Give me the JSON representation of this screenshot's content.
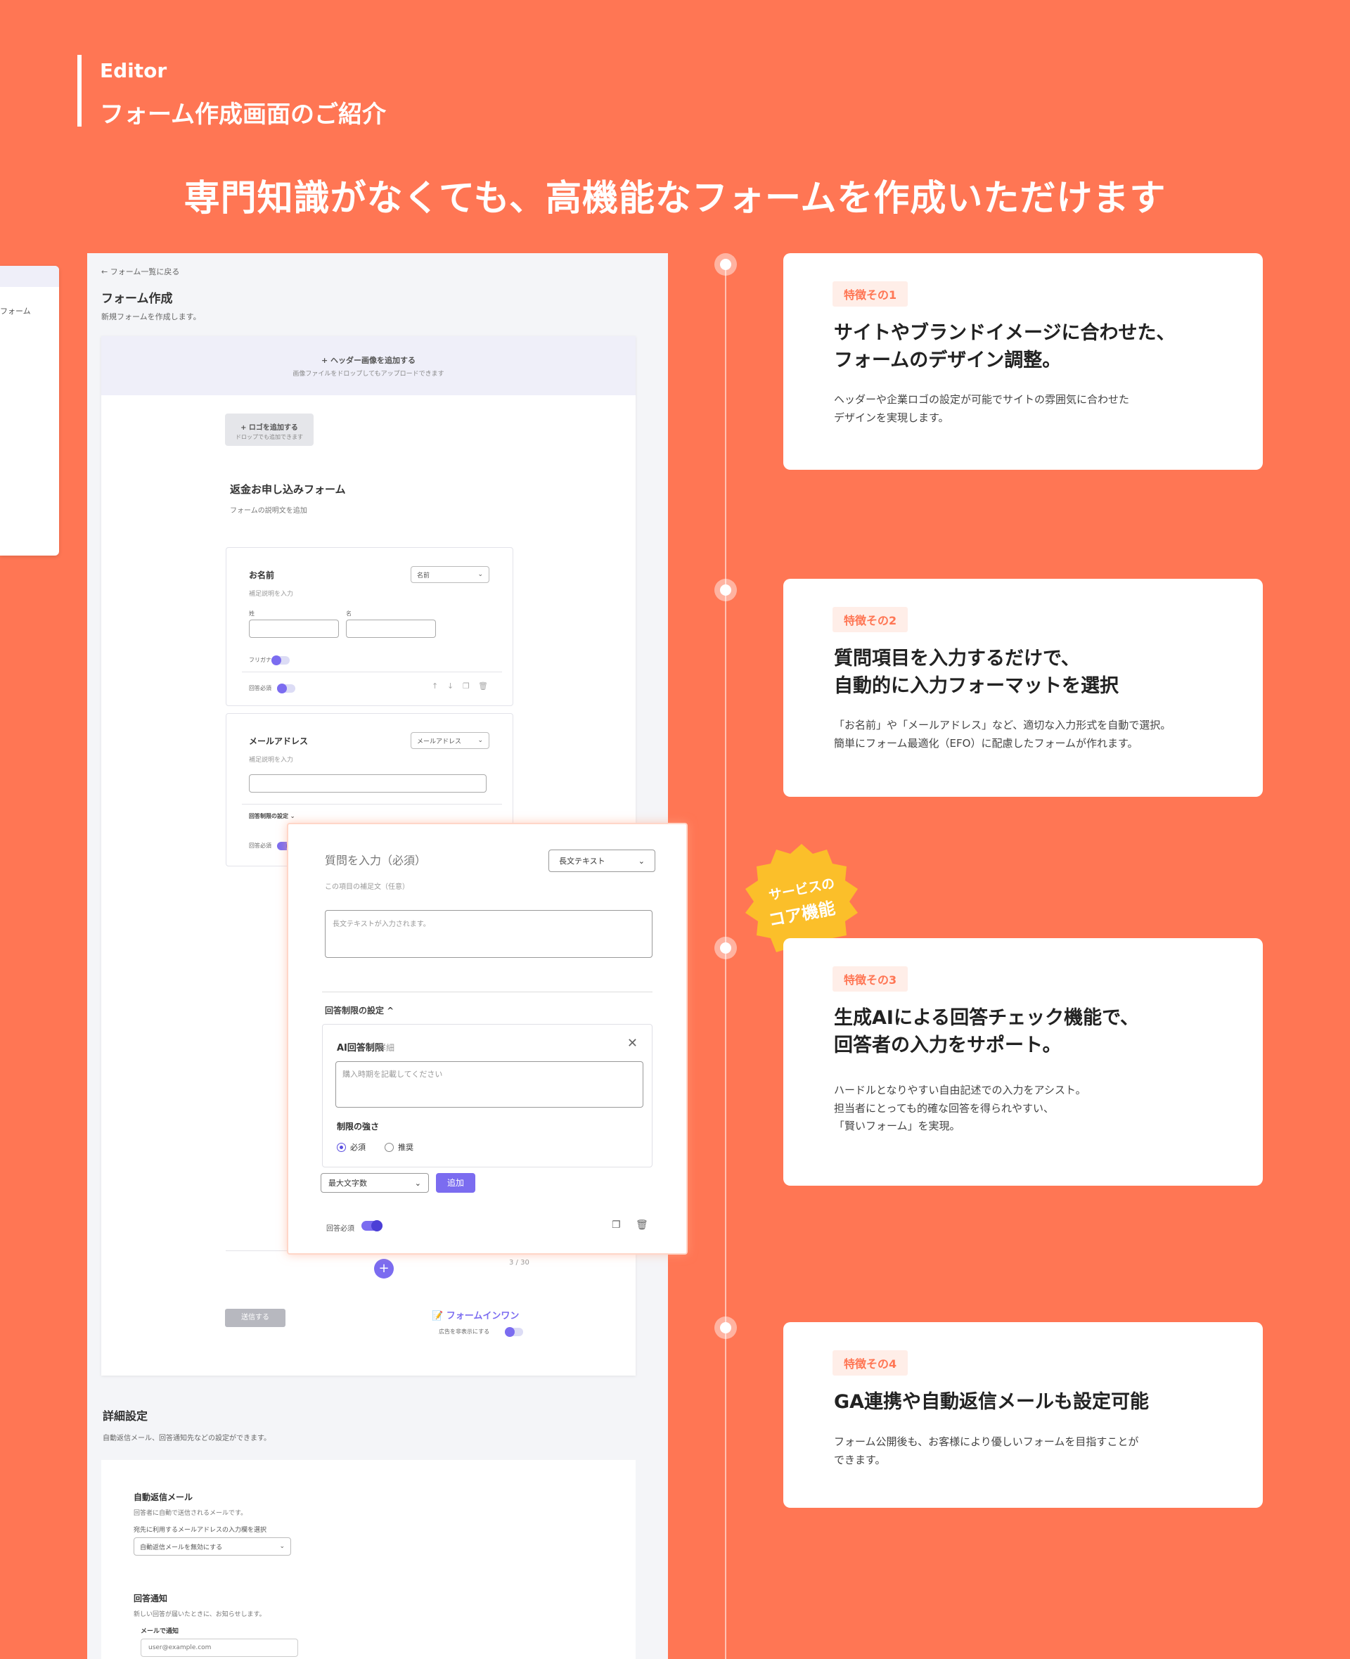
{
  "header": {
    "section": "Editor",
    "title": "フォーム作成画面のご紹介",
    "headline": "専門知識がなくても、高機能なフォームを作成いただけます"
  },
  "colors": {
    "background": "#ff7654",
    "accent": "#7b6cf0",
    "badge": "#fbbf2a"
  },
  "sidebar": {
    "item": "フォーム"
  },
  "editor": {
    "back_link": "← フォーム一覧に戻る",
    "title": "フォーム作成",
    "subtitle": "新規フォームを作成します。",
    "header_image": {
      "label": "+ ヘッダー画像を追加する",
      "hint": "画像ファイルをドロップしてもアップロードできます"
    },
    "logo": {
      "label": "+ ロゴを追加する",
      "hint": "ドロップでも追加できます"
    },
    "form_name": "返金お申し込みフォーム",
    "form_desc": "フォームの説明文を追加",
    "q1": {
      "label": "お名前",
      "type": "名前",
      "hint": "補足説明を入力",
      "last": "姓",
      "first": "名",
      "furigana": "フリガナ",
      "required": "回答必須"
    },
    "q2": {
      "label": "メールアドレス",
      "type": "メールアドレス",
      "hint": "補足説明を入力",
      "limit": "回答制限の設定 ⌄",
      "required": "回答必須"
    },
    "counter": "3 / 30",
    "add": "+",
    "send": "送信する",
    "brand": "フォームインワン",
    "brand_sub": "広告を非表示にする",
    "detail": {
      "title": "詳細設定",
      "subtitle": "自動返信メール、回答通知先などの設定ができます。",
      "auto_reply": {
        "title": "自動返信メール",
        "desc": "回答者に自動で送信されるメールです。",
        "select_label": "宛先に利用するメールアドレスの入力欄を選択",
        "select_value": "自動返信メールを無効にする"
      },
      "notify": {
        "title": "回答通知",
        "desc": "新しい回答が届いたときに、お知らせします。",
        "mail_label": "メールで通知",
        "mail_placeholder": "user@example.com"
      }
    }
  },
  "float_editor": {
    "question_placeholder": "質問を入力（必須）",
    "type": "長文テキスト",
    "sub_placeholder": "この項目の補足文（任意）",
    "textarea_placeholder": "長文テキストが入力されます。",
    "limit_label": "回答制限の設定 ^",
    "ai_title": "AI回答制限",
    "ai_detail": "詳細",
    "ai_placeholder": "購入時期を記載してください",
    "strength": "制限の強さ",
    "opt_required": "必須",
    "opt_recommend": "推奨",
    "max_select": "最大文字数",
    "add_button": "追加",
    "required": "回答必須"
  },
  "badge": {
    "line1": "サービスの",
    "line2": "コア機能"
  },
  "features": [
    {
      "tag": "特徴その1",
      "heading_1": "サイトやブランドイメージに合わせた、",
      "heading_2": "フォームのデザイン調整。",
      "text_1": "ヘッダーや企業ロゴの設定が可能でサイトの雰囲気に合わせた",
      "text_2": "デザインを実現します。",
      "text_3": ""
    },
    {
      "tag": "特徴その2",
      "heading_1": "質問項目を入力するだけで、",
      "heading_2": "自動的に入力フォーマットを選択",
      "text_1": "「お名前」や「メールアドレス」など、適切な入力形式を自動で選択。",
      "text_2": "簡単にフォーム最適化（EFO）に配慮したフォームが作れます。",
      "text_3": ""
    },
    {
      "tag": "特徴その3",
      "heading_1": "生成AIによる回答チェック機能で、",
      "heading_2": "回答者の入力をサポート。",
      "text_1": "ハードルとなりやすい自由記述での入力をアシスト。",
      "text_2": "担当者にとっても的確な回答を得られやすい、",
      "text_3": "「賢いフォーム」を実現。"
    },
    {
      "tag": "特徴その4",
      "heading_1": "GA連携や自動返信メールも設定可能",
      "heading_2": "",
      "text_1": "フォーム公開後も、お客様により優しいフォームを目指すことが",
      "text_2": "できます。",
      "text_3": ""
    }
  ]
}
